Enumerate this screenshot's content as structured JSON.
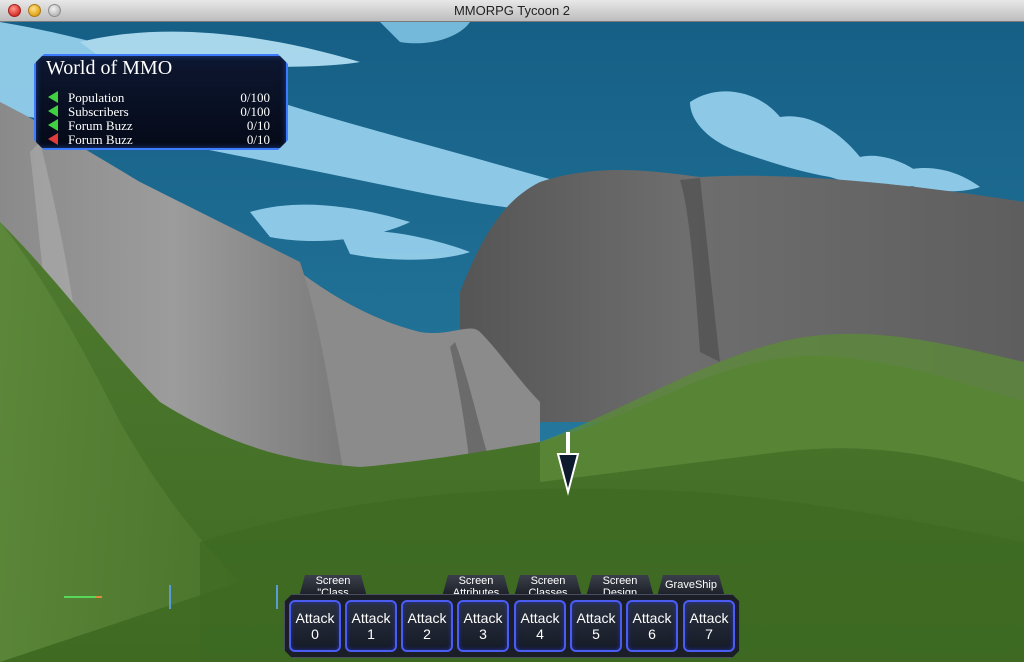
{
  "window": {
    "title": "MMORPG Tycoon 2"
  },
  "stats_panel": {
    "title": "World of MMO",
    "rows": [
      {
        "label": "Population",
        "value": "0/100",
        "trend": "up",
        "color": "#3fd13f"
      },
      {
        "label": "Subscribers",
        "value": "0/100",
        "trend": "up",
        "color": "#3fd13f"
      },
      {
        "label": "Forum Buzz",
        "value": "0/10",
        "trend": "up",
        "color": "#3fd13f"
      },
      {
        "label": "Forum Buzz",
        "value": "0/10",
        "trend": "down",
        "color": "#e23b3b"
      }
    ]
  },
  "tabs": [
    {
      "label": "Screen\n\"Class"
    },
    {
      "label": "Screen\nAttributes"
    },
    {
      "label": "Screen\nClasses"
    },
    {
      "label": "Screen\nDesign"
    },
    {
      "label": "GraveShip"
    }
  ],
  "action_bar": {
    "buttons": [
      {
        "label": "Attack\n0"
      },
      {
        "label": "Attack 1"
      },
      {
        "label": "Attack\n2"
      },
      {
        "label": "Attack\n3"
      },
      {
        "label": "Attack\n4"
      },
      {
        "label": "Attack\n5"
      },
      {
        "label": "Attack\n6"
      },
      {
        "label": "Attack\n7"
      }
    ]
  },
  "colors": {
    "sky": "#1f6f94",
    "cloud": "#9ad4f0",
    "cliff": "#6f6f6f",
    "grass": "#4e7a2e",
    "panel_border": "#3d7bff",
    "button_border": "#4b5cf0"
  }
}
